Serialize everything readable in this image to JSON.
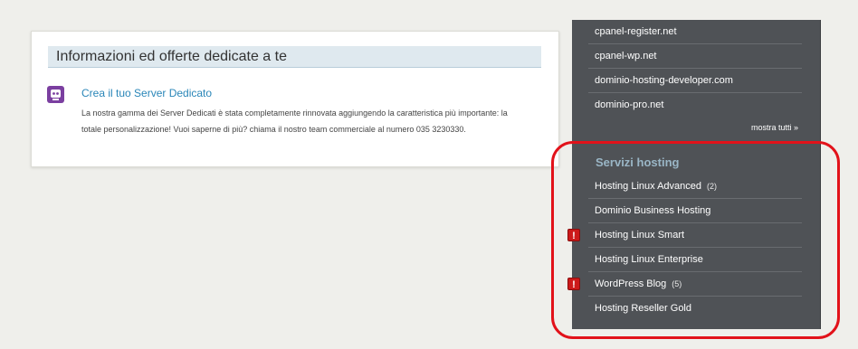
{
  "offer_card": {
    "header": "Informazioni ed offerte dedicate a te",
    "icon": "server-robot-icon",
    "title": "Crea il tuo Server Dedicato",
    "description": "La nostra gamma dei Server Dedicati è stata completamente rinnovata aggiungendo la caratteristica più importante: la totale personalizzazione! Vuoi saperne di più? chiama il nostro team commerciale al numero 035 3230330."
  },
  "sidebar": {
    "domains": [
      {
        "label": "cpanel-register.net"
      },
      {
        "label": "cpanel-wp.net"
      },
      {
        "label": "dominio-hosting-developer.com"
      },
      {
        "label": "dominio-pro.net"
      }
    ],
    "show_all": "mostra tutti »",
    "hosting_title": "Servizi hosting",
    "hosting": [
      {
        "label": "Hosting Linux Advanced",
        "count": "(2)"
      },
      {
        "label": "Dominio Business Hosting",
        "count": ""
      },
      {
        "label": "Hosting Linux Smart",
        "count": ""
      },
      {
        "label": "Hosting Linux Enterprise",
        "count": ""
      },
      {
        "label": "WordPress Blog",
        "count": "(5)"
      },
      {
        "label": "Hosting Reseller Gold",
        "count": ""
      }
    ],
    "alert_symbol": "!"
  },
  "colors": {
    "sidebar_bg": "#4f5256",
    "link": "#2a86b8",
    "highlight": "#e2121a",
    "section_title": "#9ab6c6"
  }
}
